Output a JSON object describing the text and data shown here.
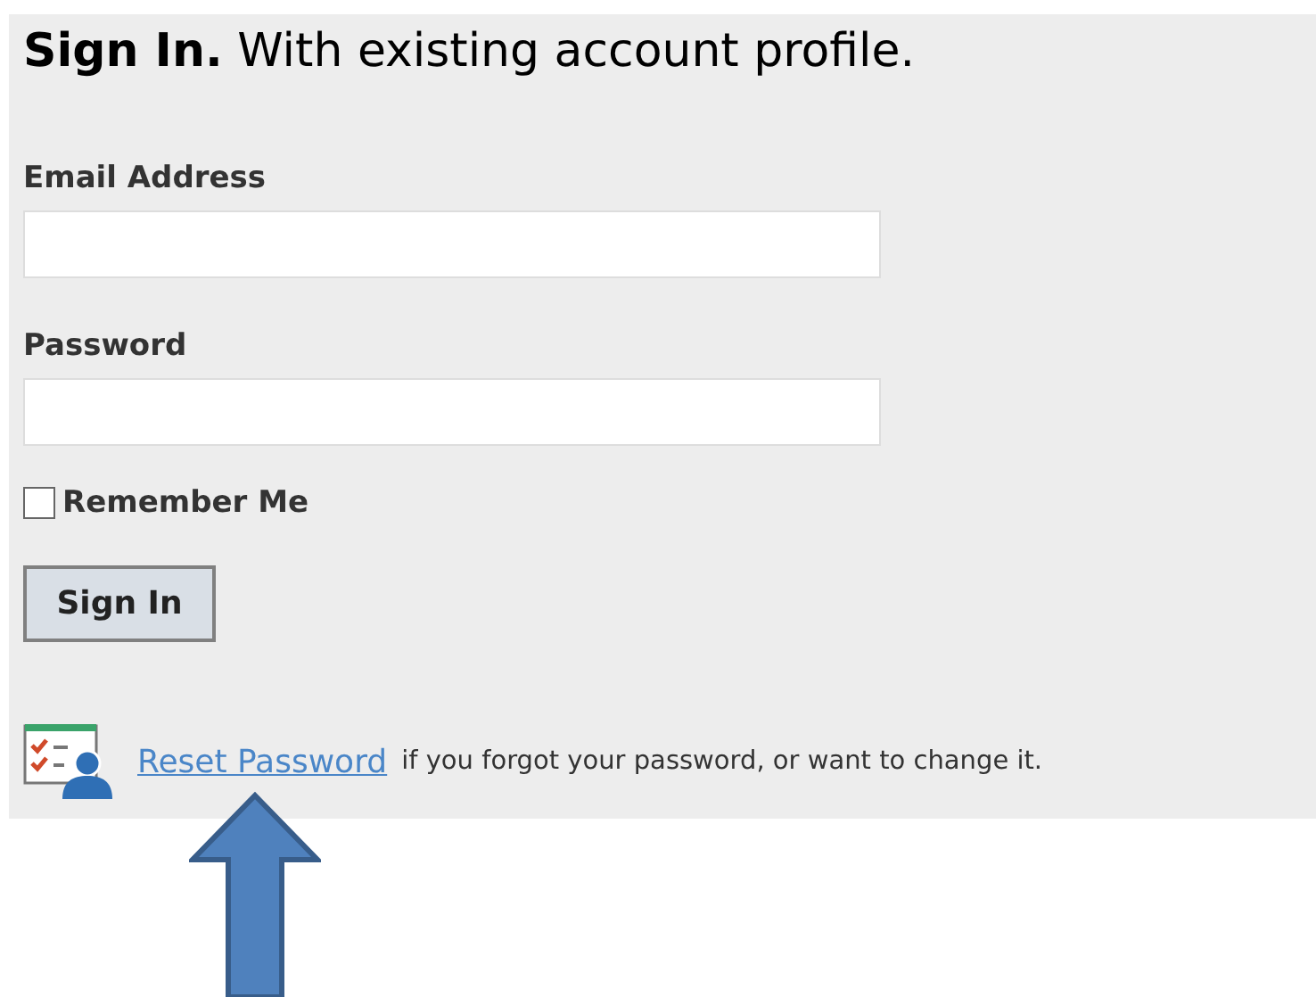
{
  "heading": "**Sign In.** With existing account profile.",
  "fields": [
    {
      "label": "Email Address"
    },
    {
      "label": "Password"
    }
  ],
  "remember": {
    "label": "Remember Me",
    "checked": false
  },
  "submit": {
    "label": "Sign In"
  },
  "reset": {
    "link": "Reset Password",
    "text": "if you forgot your password, or want to change it."
  }
}
